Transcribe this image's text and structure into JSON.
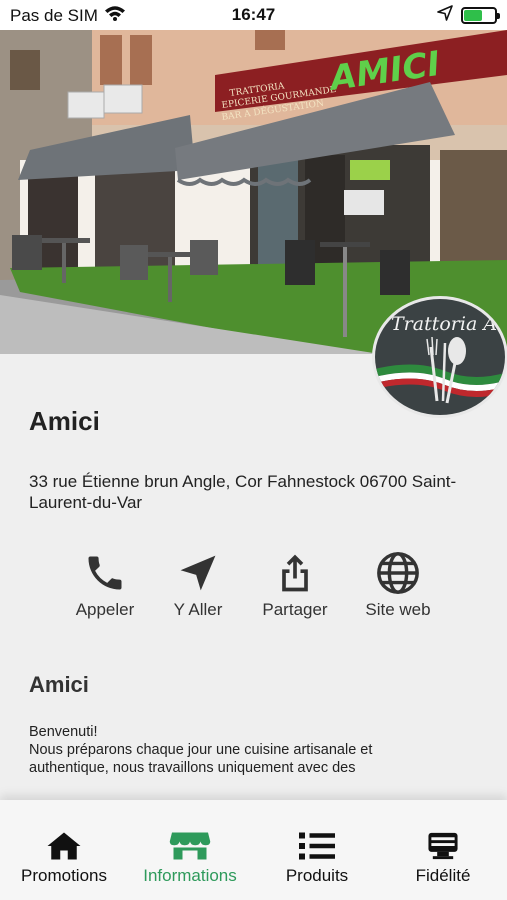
{
  "status_bar": {
    "carrier": "Pas de SIM",
    "time": "16:47",
    "battery_level": 0.6
  },
  "restaurant": {
    "name": "Amici",
    "address": "33 rue Étienne brun Angle, Cor Fahnestock 06700 Saint-Laurent-du-Var"
  },
  "hero": {
    "sign_lines": [
      "TRATTORIA",
      "EPICERIE GOURMANDE",
      "BAR A DÉGUSTATION"
    ],
    "sign_brand": "AMICI"
  },
  "logo": {
    "text": "Trattoria Amici",
    "colors": {
      "green": "#2e8b3e",
      "white": "#ffffff",
      "red": "#c0282d"
    }
  },
  "actions": [
    {
      "label": "Appeler",
      "icon": "phone-icon"
    },
    {
      "label": "Y Aller",
      "icon": "navigation-arrow-icon"
    },
    {
      "label": "Partager",
      "icon": "share-icon"
    },
    {
      "label": "Site web",
      "icon": "globe-icon"
    }
  ],
  "description": {
    "title": "Amici",
    "line1": "Benvenuti!",
    "line2": "Nous préparons chaque jour une cuisine artisanale et",
    "line3": "authentique, nous travaillons uniquement avec des"
  },
  "tabs": [
    {
      "label": "Promotions",
      "icon": "home-icon",
      "active": false
    },
    {
      "label": "Informations",
      "icon": "storefront-icon",
      "active": true
    },
    {
      "label": "Produits",
      "icon": "list-icon",
      "active": false
    },
    {
      "label": "Fidélité",
      "icon": "loyalty-card-icon",
      "active": false
    }
  ],
  "theme": {
    "accent": "#2e9a5b",
    "background": "#efefef",
    "icon_color": "#333333"
  }
}
